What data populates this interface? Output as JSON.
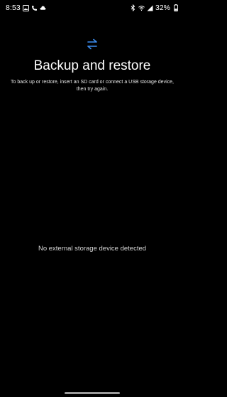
{
  "status_bar": {
    "time": "8:53",
    "battery_percent": "32%",
    "left_icons": [
      "gallery-icon",
      "phone-call-icon",
      "cloud-icon"
    ],
    "right_icons": [
      "bluetooth-icon",
      "wifi-icon",
      "signal-icon",
      "battery-icon"
    ]
  },
  "header": {
    "icon": "transfer-arrows-icon",
    "title": "Backup and restore",
    "subtitle": "To back up or restore, insert an SD card or connect a USB storage device, then try again."
  },
  "content": {
    "empty_message": "No external storage device detected"
  },
  "colors": {
    "background": "#000000",
    "accent": "#3d8ef0",
    "text": "#ffffff"
  }
}
